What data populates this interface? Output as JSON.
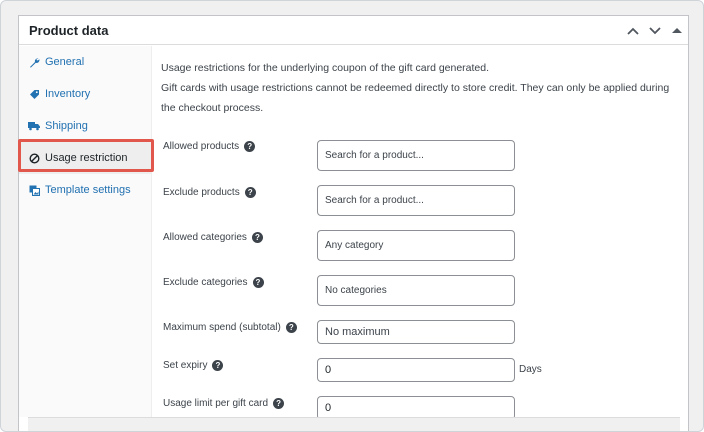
{
  "panel": {
    "title": "Product data",
    "controls": [
      "chevron-up-icon",
      "chevron-down-icon",
      "caret-up-icon"
    ]
  },
  "tabs": [
    {
      "label": "General",
      "icon": "wrench-icon"
    },
    {
      "label": "Inventory",
      "icon": "tag-icon"
    },
    {
      "label": "Shipping",
      "icon": "truck-icon"
    },
    {
      "label": "Usage restriction",
      "icon": "ban-icon",
      "active": true
    },
    {
      "label": "Template settings",
      "icon": "image-icon"
    }
  ],
  "intro": {
    "line1": "Usage restrictions for the underlying coupon of the gift card generated.",
    "line2": "Gift cards with usage restrictions cannot be redeemed directly to store credit. They can only be applied during the checkout process."
  },
  "fields": {
    "allowed_products": {
      "label": "Allowed products",
      "placeholder": "Search for a product..."
    },
    "exclude_products": {
      "label": "Exclude products",
      "placeholder": "Search for a product..."
    },
    "allowed_categories": {
      "label": "Allowed categories",
      "placeholder": "Any category"
    },
    "exclude_categories": {
      "label": "Exclude categories",
      "placeholder": "No categories"
    },
    "maximum_spend": {
      "label": "Maximum spend (subtotal)",
      "placeholder": "No maximum"
    },
    "set_expiry": {
      "label": "Set expiry",
      "value": "0",
      "unit": "Days"
    },
    "usage_limit": {
      "label": "Usage limit per gift card",
      "value": "0"
    }
  },
  "colors": {
    "link": "#2271b1",
    "highlight": "#e2574c"
  }
}
